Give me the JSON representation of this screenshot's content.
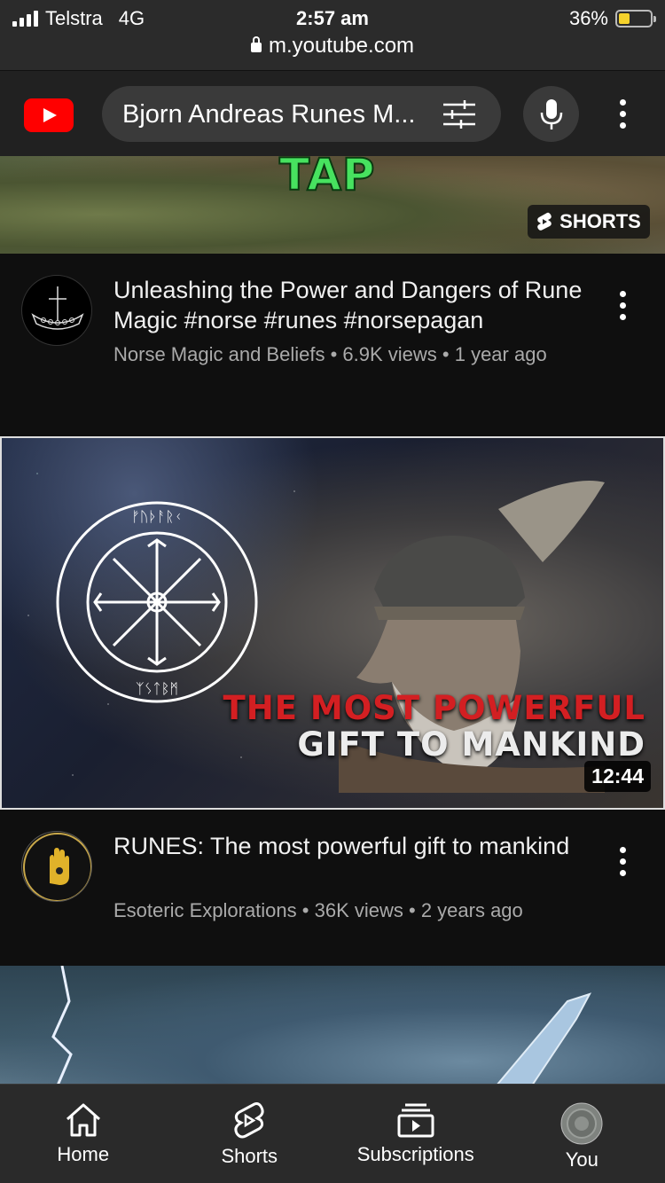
{
  "status_bar": {
    "carrier": "Telstra",
    "network": "4G",
    "time": "2:57 am",
    "battery": "36%",
    "battery_level": 0.36,
    "url": "m.youtube.com"
  },
  "header": {
    "search_query": "Bjorn Andreas Runes M..."
  },
  "shorts_badge": "SHORTS",
  "top_thumbnail_text": "TAP",
  "videos": [
    {
      "title": "Unleashing the Power and Dangers of Rune Magic #norse #runes #norsepagan",
      "channel": "Norse Magic and Beliefs",
      "views": "6.9K views",
      "age": "1 year ago"
    },
    {
      "title": "RUNES: The most powerful gift to mankind",
      "channel": "Esoteric Explorations",
      "views": "36K views",
      "age": "2 years ago",
      "thumbnail_line1": "THE MOST POWERFUL",
      "thumbnail_line2": "GIFT TO MANKIND",
      "duration": "12:44"
    }
  ],
  "bottom_nav": [
    {
      "label": "Home",
      "icon": "home-icon"
    },
    {
      "label": "Shorts",
      "icon": "shorts-icon"
    },
    {
      "label": "Subscriptions",
      "icon": "subscriptions-icon"
    },
    {
      "label": "You",
      "icon": "avatar"
    }
  ],
  "colors": {
    "brand_red": "#ff0000",
    "background": "#0f0f0f",
    "header_bg": "#212121",
    "meta_text": "#aaaaaa",
    "thumbnail_red": "#d31f22"
  }
}
